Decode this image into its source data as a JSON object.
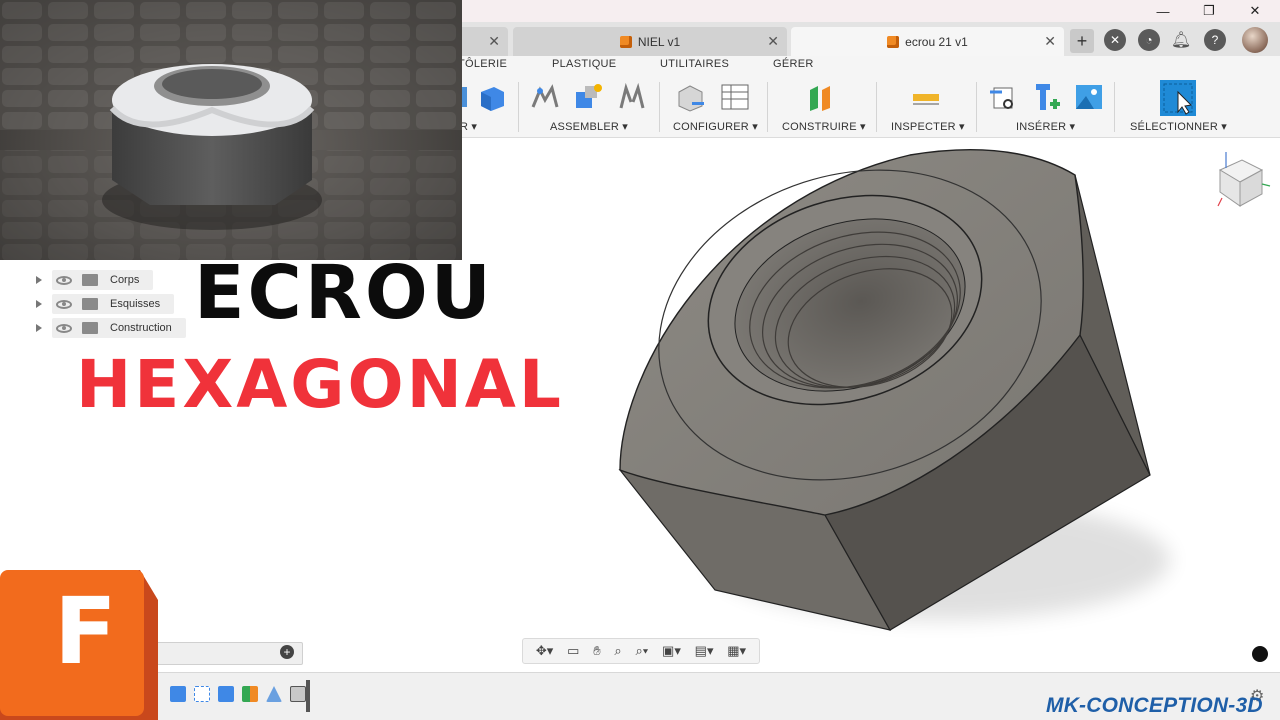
{
  "window": {
    "minimize_glyph": "—",
    "restore_glyph": "❐",
    "close_glyph": "✕"
  },
  "tabs": [
    {
      "label": "",
      "close": "✕"
    },
    {
      "label": "NIEL v1",
      "close": "✕"
    },
    {
      "label": "ecrou 21 v1",
      "close": "✕",
      "active": true
    }
  ],
  "tabbar_right": {
    "new_tab": "+",
    "icons": [
      "extensions-icon",
      "job-status-icon",
      "notifications-icon",
      "help-icon",
      "user-avatar"
    ]
  },
  "ribbon": {
    "tabs": [
      "TÔLERIE",
      "PLASTIQUE",
      "UTILITAIRES",
      "GÉRER"
    ],
    "groups": [
      "R ▾",
      "ASSEMBLER ▾",
      "CONFIGURER ▾",
      "CONSTRUIRE ▾",
      "INSPECTER ▾",
      "INSÉRER ▾",
      "SÉLECTIONNER ▾"
    ]
  },
  "browser": {
    "items": [
      "Corps",
      "Esquisses",
      "Construction"
    ]
  },
  "overlay": {
    "line1": "ECROU",
    "line2": "HEXAGONAL",
    "brand": "MK-CONCEPTION-3D"
  },
  "logo_letter": "F",
  "comments_add": "+",
  "colors": {
    "accent_red": "#f0323a",
    "brand_blue": "#1f5fa8",
    "fusion_orange": "#f26b1d"
  }
}
